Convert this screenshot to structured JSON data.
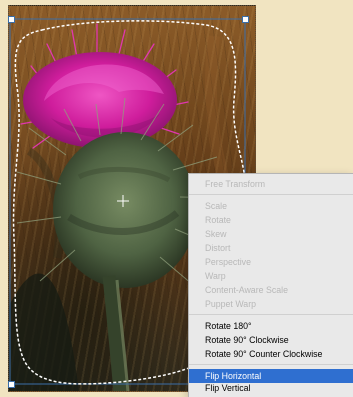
{
  "canvas": {
    "background_color": "#f1e4c1",
    "accent_color": "#2f6fd0"
  },
  "image": {
    "subject_colors": {
      "flower": "#d11f9f",
      "stem": "#4f6343",
      "background_dark": "#5c3a1a"
    }
  },
  "selection": {
    "border_color": "#3b6ea8",
    "outline_color": "#ffffff"
  },
  "context_menu": {
    "items": [
      {
        "label": "Free Transform",
        "enabled": false,
        "selected": false
      },
      {
        "label": "Scale",
        "enabled": false,
        "selected": false
      },
      {
        "label": "Rotate",
        "enabled": false,
        "selected": false
      },
      {
        "label": "Skew",
        "enabled": false,
        "selected": false
      },
      {
        "label": "Distort",
        "enabled": false,
        "selected": false
      },
      {
        "label": "Perspective",
        "enabled": false,
        "selected": false
      },
      {
        "label": "Warp",
        "enabled": false,
        "selected": false
      },
      {
        "label": "Content-Aware Scale",
        "enabled": false,
        "selected": false
      },
      {
        "label": "Puppet Warp",
        "enabled": false,
        "selected": false
      },
      {
        "label": "Rotate 180°",
        "enabled": true,
        "selected": false
      },
      {
        "label": "Rotate 90° Clockwise",
        "enabled": true,
        "selected": false
      },
      {
        "label": "Rotate 90° Counter Clockwise",
        "enabled": true,
        "selected": false
      },
      {
        "label": "Flip Horizontal",
        "enabled": true,
        "selected": true
      },
      {
        "label": "Flip Vertical",
        "enabled": true,
        "selected": false
      }
    ]
  }
}
